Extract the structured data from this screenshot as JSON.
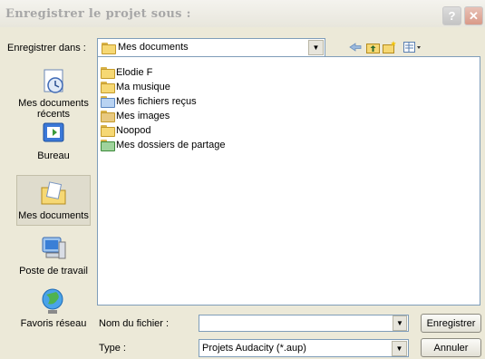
{
  "window": {
    "title": "Enregistrer le projet sous :",
    "help_symbol": "?",
    "close_symbol": "✕"
  },
  "location": {
    "label": "Enregistrer dans :",
    "value": "Mes documents",
    "toolbar": {
      "back_icon": "back-arrow-icon",
      "up_icon": "up-folder-icon",
      "new_folder_icon": "new-folder-icon",
      "views_icon": "views-menu-icon"
    }
  },
  "places": [
    {
      "label": "Mes documents récents",
      "icon": "recent-documents-icon",
      "selected": false
    },
    {
      "label": "Bureau",
      "icon": "desktop-icon",
      "selected": false
    },
    {
      "label": "Mes documents",
      "icon": "my-documents-icon",
      "selected": true
    },
    {
      "label": "Poste de travail",
      "icon": "my-computer-icon",
      "selected": false
    },
    {
      "label": "Favoris réseau",
      "icon": "network-places-icon",
      "selected": false
    }
  ],
  "files": [
    {
      "name": "Elodie F",
      "icon": "folder-icon"
    },
    {
      "name": "Ma musique",
      "icon": "music-folder-icon"
    },
    {
      "name": "Mes fichiers reçus",
      "icon": "received-files-folder-icon"
    },
    {
      "name": "Mes images",
      "icon": "pictures-folder-icon"
    },
    {
      "name": "Noopod",
      "icon": "folder-icon"
    },
    {
      "name": "Mes dossiers de partage",
      "icon": "shared-folder-icon"
    }
  ],
  "filename": {
    "label": "Nom du fichier :",
    "value": ""
  },
  "filetype": {
    "label": "Type :",
    "value": "Projets Audacity (*.aup)"
  },
  "buttons": {
    "save": "Enregistrer",
    "cancel": "Annuler"
  }
}
